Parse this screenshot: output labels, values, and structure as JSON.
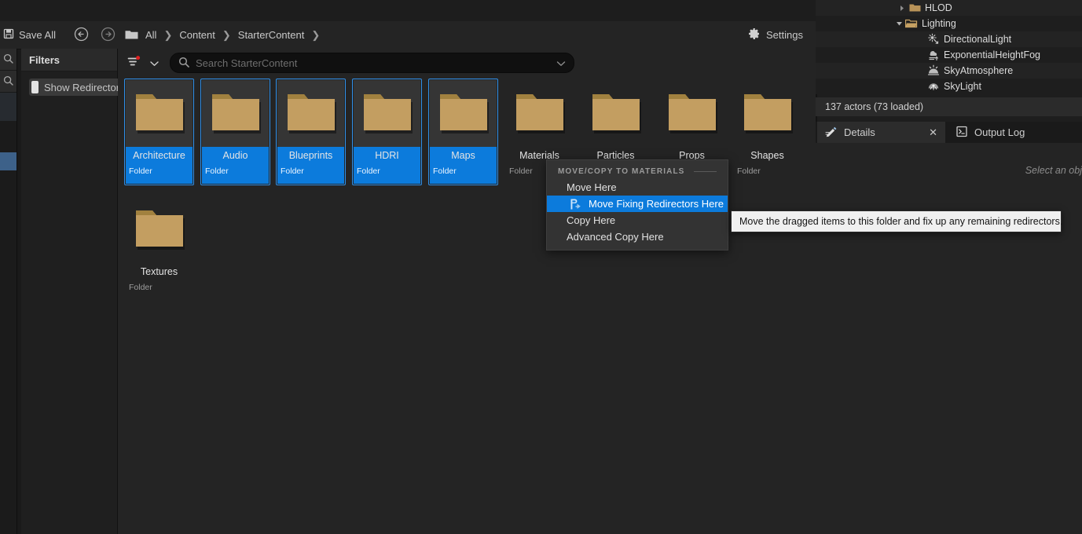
{
  "toolbar": {
    "save_all_label": "Save All",
    "back_icon": "back-arrow-icon",
    "forward_icon": "forward-arrow-icon",
    "path_root_icon": "folder-icon",
    "breadcrumbs": [
      "All",
      "Content",
      "StarterContent"
    ],
    "separator": "❯",
    "settings_label": "Settings"
  },
  "filters_panel": {
    "header": "Filters",
    "chips": [
      {
        "label": "Show Redirectors",
        "color": "#e3e3e3"
      }
    ]
  },
  "asset_toolbar": {
    "filter_icon": "filter-icon",
    "chevron_icon": "chevron-down-icon",
    "search_icon": "search-icon",
    "search_placeholder": "Search StarterContent",
    "search_value": "",
    "search_dropdown_icon": "chevron-down-icon"
  },
  "assets": {
    "type_label": "Folder",
    "items": [
      {
        "name": "Architecture",
        "type": "Folder",
        "selected": true
      },
      {
        "name": "Audio",
        "type": "Folder",
        "selected": true
      },
      {
        "name": "Blueprints",
        "type": "Folder",
        "selected": true
      },
      {
        "name": "HDRI",
        "type": "Folder",
        "selected": true
      },
      {
        "name": "Maps",
        "type": "Folder",
        "selected": true
      },
      {
        "name": "Materials",
        "type": "Folder",
        "selected": false
      },
      {
        "name": "Particles",
        "type": "Folder",
        "selected": false
      },
      {
        "name": "Props",
        "type": "Folder",
        "selected": false
      },
      {
        "name": "Shapes",
        "type": "Folder",
        "selected": false
      },
      {
        "name": "Textures",
        "type": "Folder",
        "selected": false
      }
    ]
  },
  "context_menu": {
    "heading": "MOVE/COPY TO MATERIALS",
    "items": [
      {
        "label": "Move Here",
        "highlighted": false,
        "icon": null
      },
      {
        "label": "Move Fixing Redirectors Here",
        "highlighted": true,
        "icon": "redirector-icon"
      },
      {
        "label": "Copy Here",
        "highlighted": false,
        "icon": null
      },
      {
        "label": "Advanced Copy Here",
        "highlighted": false,
        "icon": null
      }
    ],
    "highlight_color": "#0c7bdc"
  },
  "tooltip": {
    "text": "Move the dragged items to this folder and fix up any remaining redirectors."
  },
  "outliner": {
    "rows": [
      {
        "label": "HLOD",
        "icon": "folder-icon",
        "arrow": "collapsed",
        "indent": 104,
        "shade": "alt"
      },
      {
        "label": "Lighting",
        "icon": "folder-open-icon",
        "arrow": "expanded",
        "indent": 100,
        "shade": "plain"
      },
      {
        "label": "DirectionalLight",
        "icon": "directional-light-icon",
        "arrow": "none",
        "indent": 140,
        "shade": "alt"
      },
      {
        "label": "ExponentialHeightFog",
        "icon": "height-fog-icon",
        "arrow": "none",
        "indent": 140,
        "shade": "plain"
      },
      {
        "label": "SkyAtmosphere",
        "icon": "sky-atmosphere-icon",
        "arrow": "none",
        "indent": 140,
        "shade": "alt"
      },
      {
        "label": "SkyLight",
        "icon": "sky-light-icon",
        "arrow": "none",
        "indent": 140,
        "shade": "plain"
      }
    ],
    "status": "137 actors (73 loaded)"
  },
  "right_tabs": {
    "tabs": [
      {
        "label": "Details",
        "icon": "details-icon",
        "active": true,
        "closable": true,
        "close_glyph": "✕"
      },
      {
        "label": "Output Log",
        "icon": "output-log-icon",
        "active": false,
        "closable": false
      }
    ],
    "details_empty_text": "Select an obj"
  },
  "edge_strip": {
    "buttons": [
      {
        "icon": "search-icon"
      },
      {
        "icon": "search-icon"
      }
    ]
  }
}
